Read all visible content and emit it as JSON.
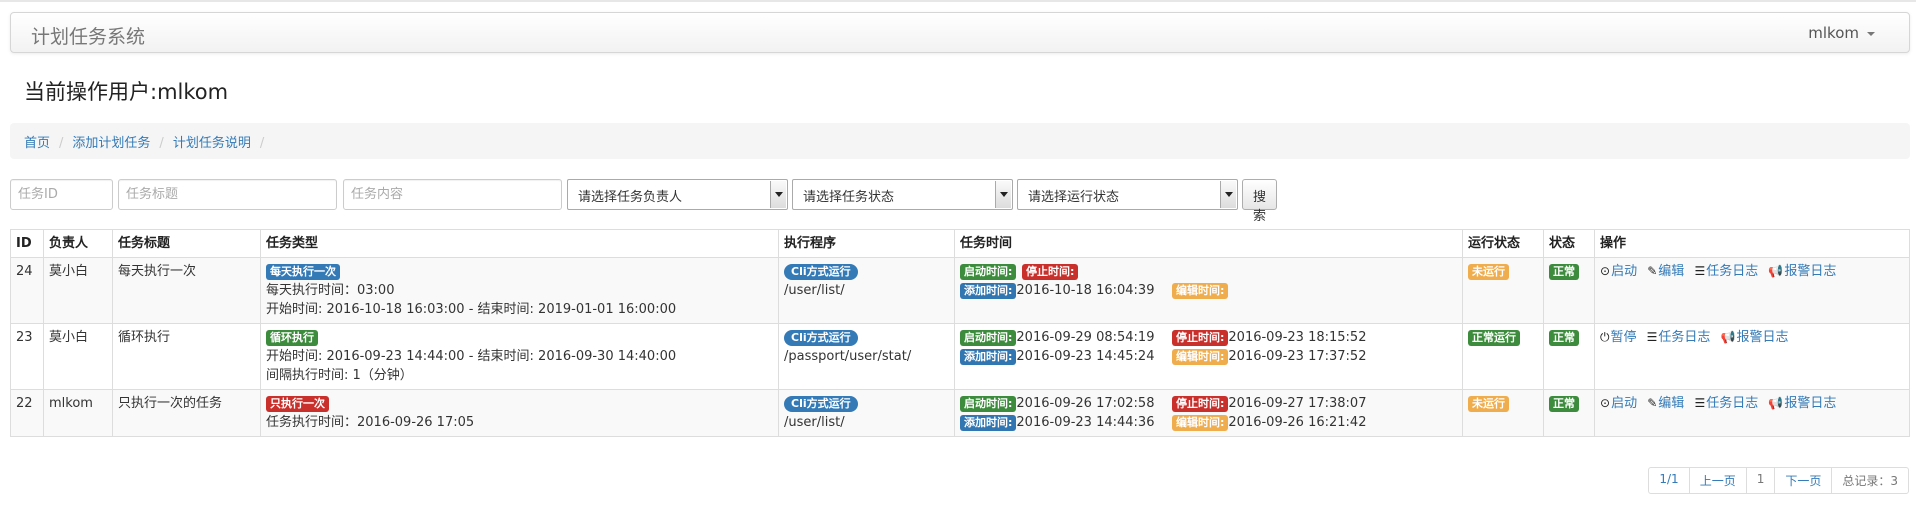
{
  "navbar": {
    "brand": "计划任务系统",
    "user": "mlkom"
  },
  "page_title": "当前操作用户:mlkom",
  "breadcrumb": [
    "首页",
    "添加计划任务",
    "计划任务说明"
  ],
  "filters": {
    "id_placeholder": "任务ID",
    "title_placeholder": "任务标题",
    "content_placeholder": "任务内容",
    "owner_select": "请选择任务负责人",
    "status_select": "请选择任务状态",
    "run_select": "请选择运行状态",
    "search_label": "搜索"
  },
  "table": {
    "headers": [
      "ID",
      "负责人",
      "任务标题",
      "任务类型",
      "执行程序",
      "任务时间",
      "运行状态",
      "状态",
      "操作"
    ],
    "rows": [
      {
        "id": "24",
        "owner": "莫小白",
        "title": "每天执行一次",
        "type_label": "每天执行一次",
        "type_color": "#337ab7",
        "type_lines": [
          "每天执行时间：03:00",
          "开始时间: 2016-10-18 16:03:00 - 结束时间: 2019-01-01 16:00:00"
        ],
        "exec_label": "Cli方式运行",
        "exec_path": "/user/list/",
        "time_start_label": "启动时间:",
        "time_start": "",
        "time_stop_label": "停止时间:",
        "time_stop": "",
        "time_add_label": "添加时间:",
        "time_add": "2016-10-18 16:04:39",
        "time_edit_label": "编辑时间:",
        "time_edit": "",
        "run_status": "未运行",
        "run_color": "#f0ad4e",
        "status": "正常",
        "ops": [
          "启动",
          "编辑",
          "任务日志",
          "报警日志"
        ]
      },
      {
        "id": "23",
        "owner": "莫小白",
        "title": "循环执行",
        "type_label": "循环执行",
        "type_color": "#3d8b3d",
        "type_lines": [
          "开始时间: 2016-09-23 14:44:00 - 结束时间: 2016-09-30 14:40:00",
          "间隔执行时间: 1（分钟）"
        ],
        "exec_label": "Cli方式运行",
        "exec_path": "/passport/user/stat/",
        "time_start_label": "启动时间:",
        "time_start": "2016-09-29 08:54:19",
        "time_stop_label": "停止时间:",
        "time_stop": "2016-09-23 18:15:52",
        "time_add_label": "添加时间:",
        "time_add": "2016-09-23 14:45:24",
        "time_edit_label": "编辑时间:",
        "time_edit": "2016-09-23 17:37:52",
        "run_status": "正常运行",
        "run_color": "#3d8b3d",
        "status": "正常",
        "ops": [
          "暂停",
          "任务日志",
          "报警日志"
        ]
      },
      {
        "id": "22",
        "owner": "mlkom",
        "title": "只执行一次的任务",
        "type_label": "只执行一次",
        "type_color": "#c9302c",
        "type_lines": [
          "任务执行时间：2016-09-26 17:05"
        ],
        "exec_label": "Cli方式运行",
        "exec_path": "/user/list/",
        "time_start_label": "启动时间:",
        "time_start": "2016-09-26 17:02:58",
        "time_stop_label": "停止时间:",
        "time_stop": "2016-09-27 17:38:07",
        "time_add_label": "添加时间:",
        "time_add": "2016-09-23 14:44:36",
        "time_edit_label": "编辑时间:",
        "time_edit": "2016-09-26 16:21:42",
        "run_status": "未运行",
        "run_color": "#f0ad4e",
        "status": "正常",
        "ops": [
          "启动",
          "编辑",
          "任务日志",
          "报警日志"
        ]
      }
    ]
  },
  "pager": [
    "1/1",
    "上一页",
    "1",
    "下一页",
    "总记录：3"
  ],
  "colors": {
    "link": "#337ab7",
    "green": "#3d8b3d",
    "red": "#c9302c",
    "orange": "#f0ad4e"
  }
}
